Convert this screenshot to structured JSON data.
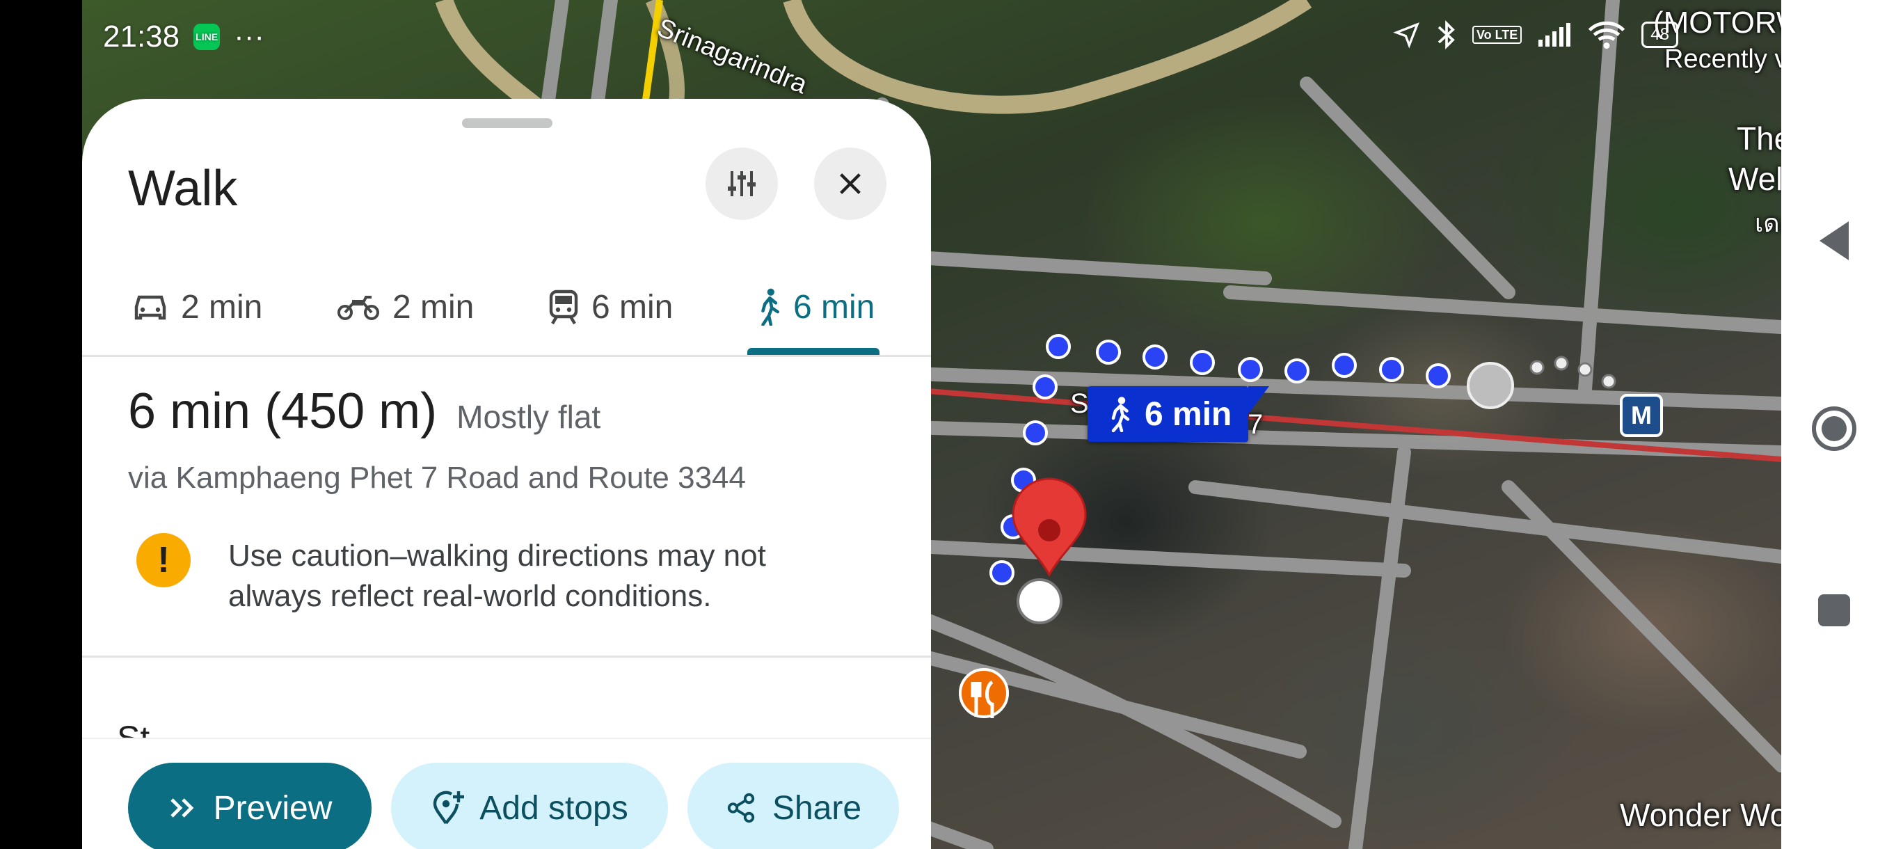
{
  "status_bar": {
    "time": "21:38",
    "line_app": "LINE",
    "more": "···",
    "volte": "Vo LTE",
    "battery": "48",
    "icons": [
      "navigation-arrow-icon",
      "bluetooth-icon",
      "signal-icon",
      "wifi-icon"
    ]
  },
  "map": {
    "labels": {
      "srinagarindra": "Srinagarindra",
      "motorway": "(MOTORW",
      "recently": "Recently v",
      "the": "The S",
      "wellness": "Welln",
      "thai": "เดอะ",
      "wonder": "Wonder Woo",
      "road_s": "S",
      "road_7": "7"
    },
    "route_chip": "6 min",
    "metro": "M",
    "colors": {
      "route": "#2a44f5",
      "chip": "#0b30d0",
      "rail": "#c23636",
      "highway": "#f5d000"
    }
  },
  "panel": {
    "title": "Walk",
    "tabs": [
      {
        "mode": "car-icon",
        "label": "2 min"
      },
      {
        "mode": "motorcycle-icon",
        "label": "2 min"
      },
      {
        "mode": "transit-icon",
        "label": "6 min"
      },
      {
        "mode": "walk-icon",
        "label": "6 min",
        "active": true
      }
    ],
    "summary": {
      "time_distance": "6 min (450 m)",
      "terrain": "Mostly flat",
      "via": "via Kamphaeng Phet 7 Road and Route 3344",
      "warning": "Use caution–walking directions may not always reflect real-world conditions."
    },
    "steps_peek": "St",
    "actions": {
      "preview": "Preview",
      "add_stops": "Add stops",
      "share": "Share"
    },
    "accent": "#0b6e82"
  }
}
